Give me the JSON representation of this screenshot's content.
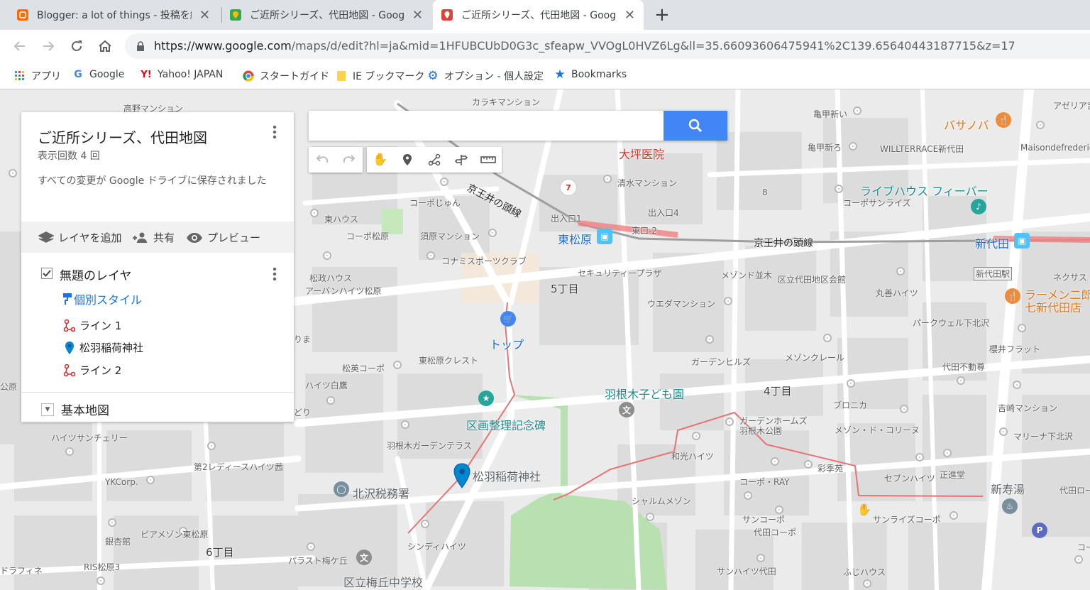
{
  "browser": {
    "tabs": [
      {
        "title": "Blogger: a lot of things - 投稿を編集",
        "active": false
      },
      {
        "title": "ご近所シリーズ、代田地図 - Google マイマップ",
        "active": false
      },
      {
        "title": "ご近所シリーズ、代田地図 - Google マイマップ",
        "active": true
      }
    ],
    "close_glyph": "✕",
    "new_tab_glyph": "+",
    "url_host": "https://www.google.com",
    "url_path": "/maps/d/edit?hl=ja&mid=1HFUBCUbD0G3c_sfeapw_VVOgL0HVZ6Lg&ll=35.66093606475941%2C139.65640443187715&z=17",
    "bookmarks": [
      "アプリ",
      "Google",
      "Yahoo! JAPAN",
      "スタートガイド",
      "IE ブックマーク",
      "オプション - 個人設定",
      "Bookmarks"
    ]
  },
  "panel": {
    "title": "ご近所シリーズ、代田地図",
    "views": "表示回数 4 回",
    "saved_status": "すべての変更が Google ドライブに保存されました",
    "actions": {
      "add_layer": "レイヤを追加",
      "share": "共有",
      "preview": "プレビュー"
    },
    "layer": {
      "name": "無題のレイヤ",
      "style": "個別スタイル",
      "features": [
        "ライン 1",
        "松羽稲荷神社",
        "ライン 2"
      ]
    },
    "basemap": "基本地図"
  },
  "search": {
    "placeholder": ""
  },
  "map": {
    "line_label_left": "京王井の頭線",
    "line_label_right": "京王井の頭線",
    "stations": [
      "東松原",
      "新代田",
      "新代田駅"
    ],
    "big_places": [
      "大坪医院",
      "羽根木子ども園",
      "区画整理記念碑",
      "松羽稲荷神社",
      "北沢税務署",
      "区立梅丘中学校",
      "ライブハウス フィーバー",
      "バサノバ",
      "ラーメン二郎",
      "七新代田店",
      "新寿湯",
      "トップ"
    ],
    "labels": [
      "高野マンション",
      "カラキマンション",
      "亀甲新い",
      "亀甲新ろ",
      "アゼリア吉",
      "WILLTERRACE新代田",
      "Maisondefrederic",
      "清水マンション",
      "コーポじゅん",
      "東ハウス",
      "コーポ松原",
      "須原マンション",
      "出入口1",
      "出入口4",
      "東口-2",
      "コーポサンライズ",
      "8",
      "コナミスポーツクラブ",
      "松政ハウス",
      "アーバンハイツ松原",
      "セキュリティープラザ",
      "メゾンド並木",
      "区立代田地区会館",
      "丸善ハイツ",
      "ネクサス",
      "5丁目",
      "ウエダマンション",
      "パークウェル下北沢",
      "東松原クレスト",
      "松英コーポ",
      "ハイツ白鷹",
      "櫻井フラット",
      "ガーデンヒルズ",
      "メゾンクレール",
      "代田不動尊",
      "4丁目",
      "ブロニカ",
      "吉崎マンション",
      "ガーデンホームズ",
      "羽根木公園",
      "メゾン・ド・コリーヌ",
      "マリーナ下北沢",
      "ハイツサンチェリー",
      "羽根木ガーデンテラス",
      "和光ハイツ",
      "彩季苑",
      "セブンハイツ",
      "正進堂",
      "第2レディースハイツ茜",
      "コーポ・RAY",
      "代田ロー",
      "YKCorp.",
      "シャルムメゾン",
      "サンライズコーポ",
      "サンコーポ",
      "代田コーポ",
      "ピアメゾン東松原",
      "銀杏館",
      "6丁目",
      "シンディハイツ",
      "パラスト梅ケ丘",
      "RIS松原3",
      "ドラフィネ",
      "サンハイツ代田",
      "ふじハウス",
      "コート",
      "りま",
      "どり",
      "公原"
    ]
  },
  "colors": {
    "accent": "#4285f4",
    "route": "#e57373",
    "marker": "#0288d1",
    "rail": "#9e9e9e"
  }
}
